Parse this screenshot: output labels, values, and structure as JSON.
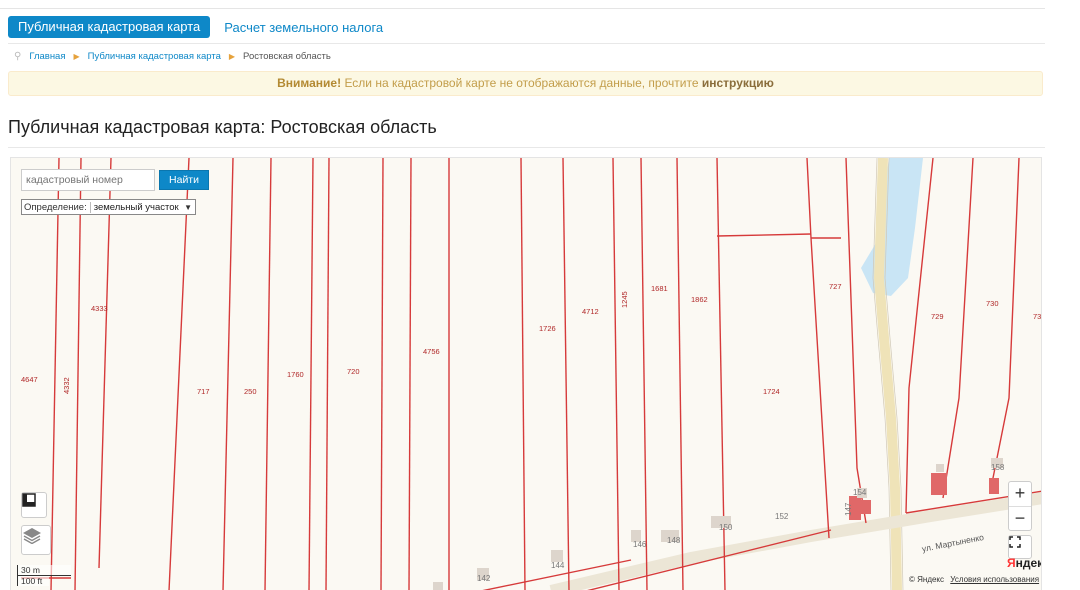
{
  "tabs": {
    "active": "Публичная кадастровая карта",
    "second": "Расчет земельного налога"
  },
  "breadcrumb": {
    "home": "Главная",
    "map": "Публичная кадастровая карта",
    "current": "Ростовская область"
  },
  "alert": {
    "strong": "Внимание!",
    "text": "Если на кадастровой карте не отображаются данные, прочтите",
    "link": "инструкцию"
  },
  "page": {
    "title": "Публичная кадастровая карта: Ростовская область"
  },
  "map": {
    "search_placeholder": "кадастровый номер",
    "search_button": "Найти",
    "definition_label": "Определение:",
    "definition_value": "земельный участок",
    "zoom_in": "+",
    "zoom_out": "−",
    "scale_m": "30 m",
    "scale_ft": "100 ft",
    "brand_y": "Я",
    "brand_rest": "ндекс",
    "copyright": "© Яндекс",
    "terms": "Условия использования",
    "street": "ул. Мартыненко",
    "parcels": [
      "4647",
      "4332",
      "4333",
      "717",
      "250",
      "1760",
      "720",
      "4756",
      "1726",
      "4712",
      "1245",
      "1681",
      "1862",
      "727",
      "1724",
      "729",
      "730",
      "73",
      "152",
      "154",
      "147",
      "150",
      "148",
      "146",
      "144",
      "142",
      "158"
    ]
  },
  "colors": {
    "accent": "#0e88c8",
    "parcel_line": "#d63a3a",
    "water": "#c9e5f5",
    "building": "#e06868"
  }
}
